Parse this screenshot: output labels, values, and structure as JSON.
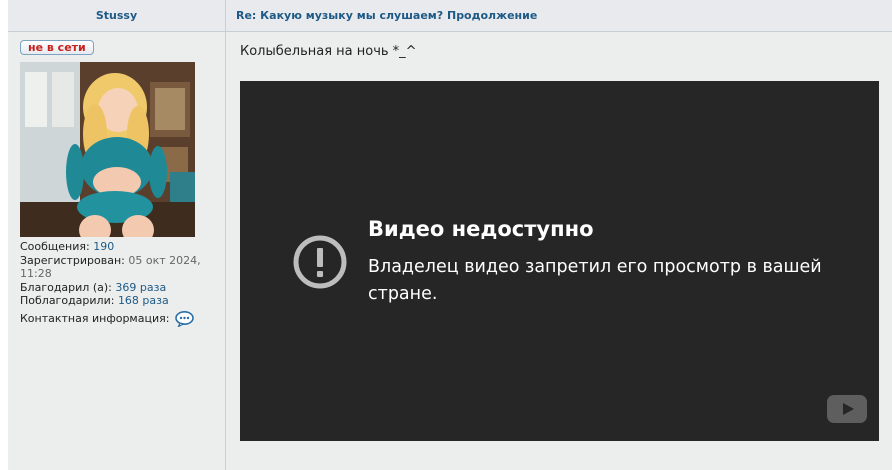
{
  "header": {
    "author_name": "Stussy",
    "topic_title": "Re: Какую музыку мы слушаем? Продолжение"
  },
  "profile": {
    "status": "не в сети",
    "posts_label": "Сообщения:",
    "posts_value": "190",
    "registered_label": "Зарегистрирован:",
    "registered_value": "05 окт 2024, 11:28",
    "thanked_label": "Благодарил (а):",
    "thanked_value": "369 раза",
    "was_thanked_label": "Поблагодарили:",
    "was_thanked_value": "168 раза",
    "contact_label": "Контактная информация:",
    "contact_icon": "chat-bubble-icon"
  },
  "post": {
    "text": "Колыбельная на ночь *_^"
  },
  "video": {
    "title": "Видео недоступно",
    "message": "Владелец видео запретил его просмотр в вашей стране.",
    "icons": [
      "warning-icon",
      "youtube-icon"
    ]
  },
  "colors": {
    "link": "#1e5a86",
    "status_red": "#c8201c",
    "panel_bg": "#eceded",
    "video_bg": "#262626"
  }
}
